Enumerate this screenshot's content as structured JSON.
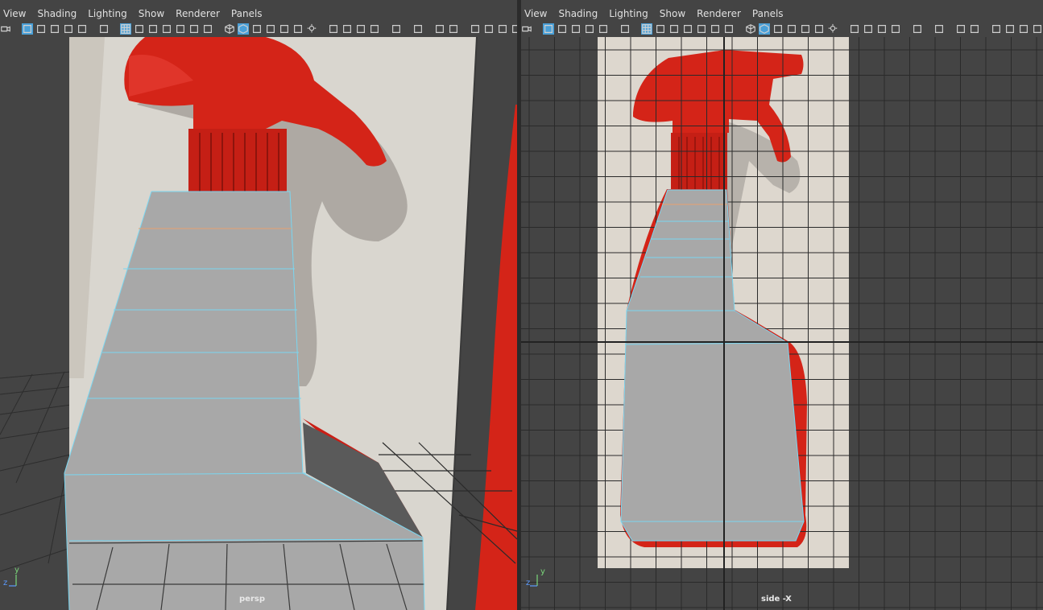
{
  "left_panel": {
    "menu": [
      "View",
      "Shading",
      "Lighting",
      "Show",
      "Renderer",
      "Panels"
    ],
    "camera_label": "persp",
    "axis": {
      "y": "y",
      "z": "z"
    }
  },
  "right_panel": {
    "menu": [
      "View",
      "Shading",
      "Lighting",
      "Show",
      "Renderer",
      "Panels"
    ],
    "camera_label": "side -X",
    "axis": {
      "y": "y",
      "z": "z"
    }
  },
  "colors": {
    "viewport_bg": "#444444",
    "bottle_red": "#d42418",
    "mesh_gray": "#a8a8a8",
    "edge_cyan": "#7ad6f0",
    "selected_edge": "#e8a070",
    "grid_line": "#2a2a2a",
    "active_icon": "#4aa0d8"
  },
  "toolbar_icons": [
    "camera-icon",
    "lock-camera-icon",
    "camera-attr-icon",
    "bookmark-icon",
    "image-plane-icon",
    "2d-pan-icon",
    "grease-pencil-icon",
    "grid-icon",
    "film-gate-icon",
    "resolution-gate-icon",
    "gate-mask-icon",
    "field-chart-icon",
    "safe-action-icon",
    "safe-title-icon",
    "wireframe-icon",
    "smooth-shade-icon",
    "default-material-icon",
    "wireframe-on-shaded-icon",
    "xray-icon",
    "textured-icon",
    "lights-icon",
    "shadows-icon",
    "ambient-occlusion-icon",
    "motion-blur-icon",
    "anti-alias-icon",
    "depth-of-field-icon",
    "isolate-icon",
    "xray-joints-icon",
    "xray-active-icon",
    "single-view-icon",
    "four-view-icon",
    "maximize-icon",
    "hud-icon"
  ]
}
